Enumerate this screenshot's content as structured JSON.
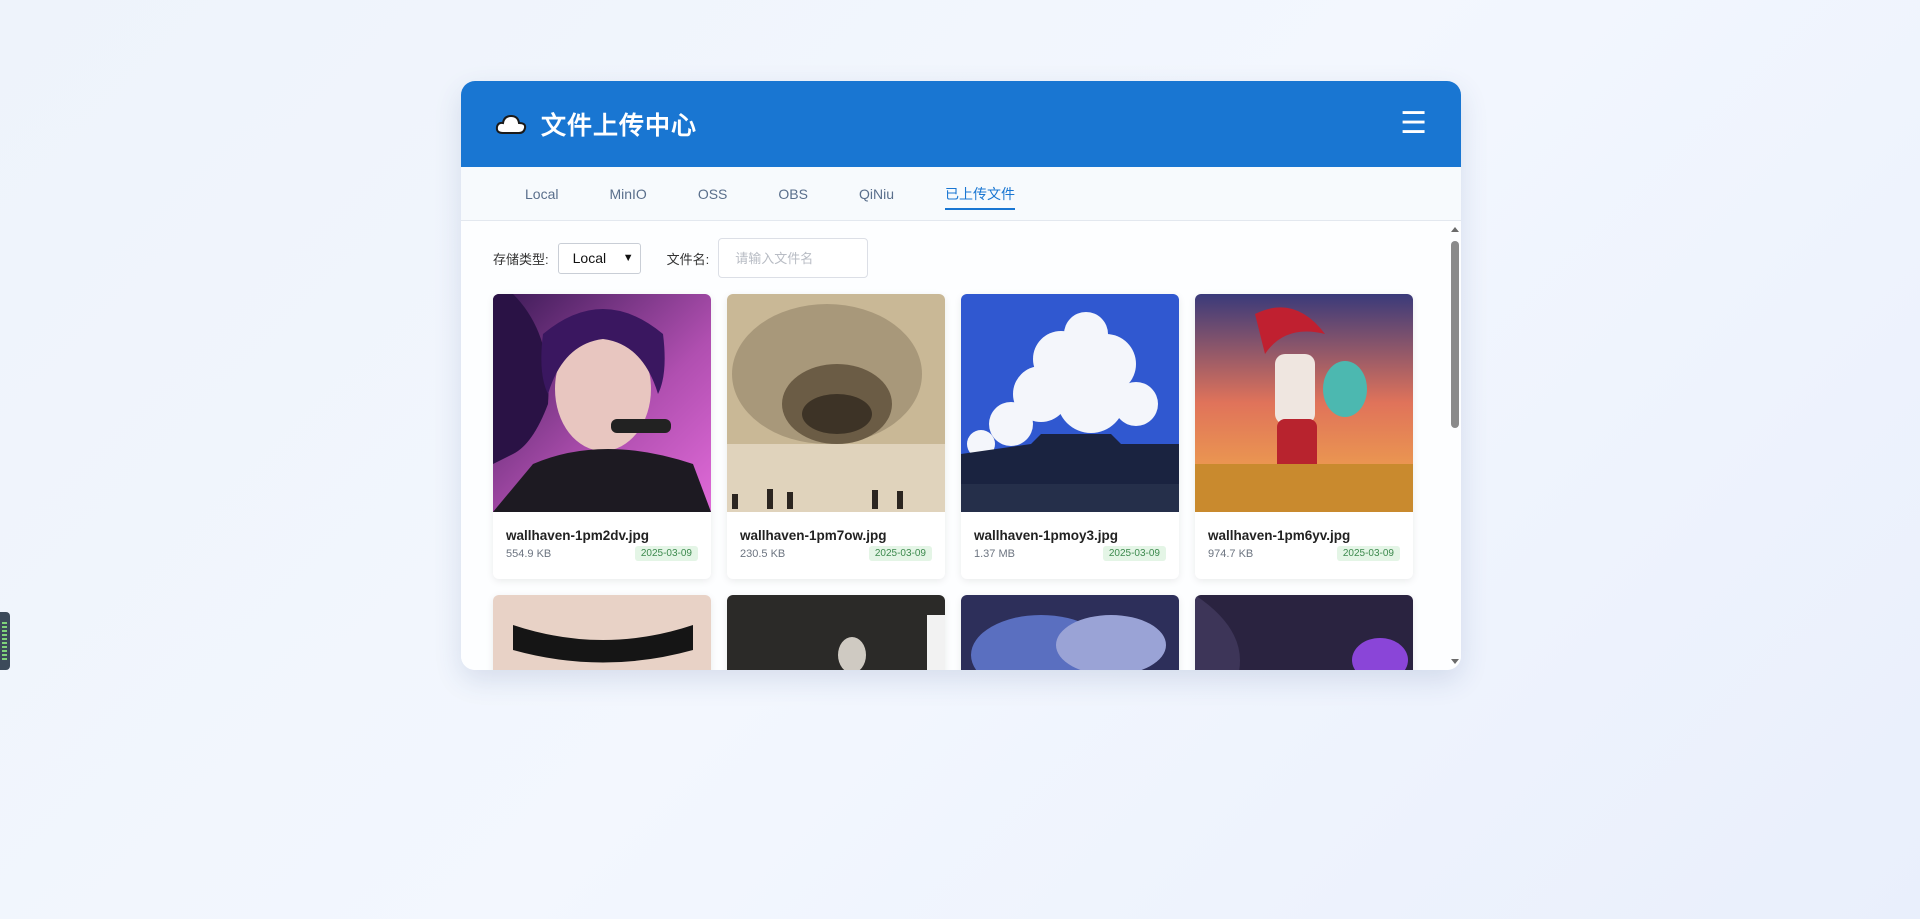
{
  "header": {
    "title": "文件上传中心",
    "cloud_icon": "cloud-icon",
    "menu_icon": "hamburger-menu-icon",
    "menu_glyph": "☰",
    "color": "#1976d2"
  },
  "tabs": [
    {
      "label": "Local",
      "active": false
    },
    {
      "label": "MinIO",
      "active": false
    },
    {
      "label": "OSS",
      "active": false
    },
    {
      "label": "OBS",
      "active": false
    },
    {
      "label": "QiNiu",
      "active": false
    },
    {
      "label": "已上传文件",
      "active": true
    }
  ],
  "filters": {
    "storage_label": "存储类型:",
    "storage_value": "Local",
    "filename_label": "文件名:",
    "filename_placeholder": "请输入文件名"
  },
  "files": [
    {
      "name": "wallhaven-1pm2dv.jpg",
      "size": "554.9 KB",
      "date": "2025-03-09"
    },
    {
      "name": "wallhaven-1pm7ow.jpg",
      "size": "230.5 KB",
      "date": "2025-03-09"
    },
    {
      "name": "wallhaven-1pmoy3.jpg",
      "size": "1.37 MB",
      "date": "2025-03-09"
    },
    {
      "name": "wallhaven-1pm6yv.jpg",
      "size": "974.7 KB",
      "date": "2025-03-09"
    }
  ]
}
